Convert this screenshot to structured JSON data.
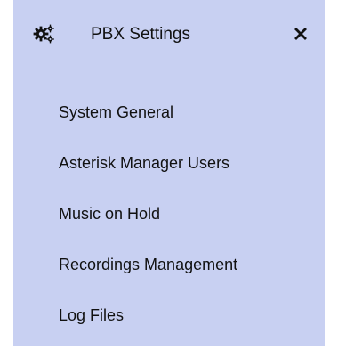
{
  "panel": {
    "title": "PBX Settings",
    "icon": "gear-icon",
    "close_icon": "close-icon",
    "background_color": "#c8d0f2"
  },
  "menu": {
    "items": [
      {
        "label": "System General"
      },
      {
        "label": "Asterisk Manager Users"
      },
      {
        "label": "Music on Hold"
      },
      {
        "label": "Recordings Management"
      },
      {
        "label": "Log Files"
      }
    ]
  }
}
